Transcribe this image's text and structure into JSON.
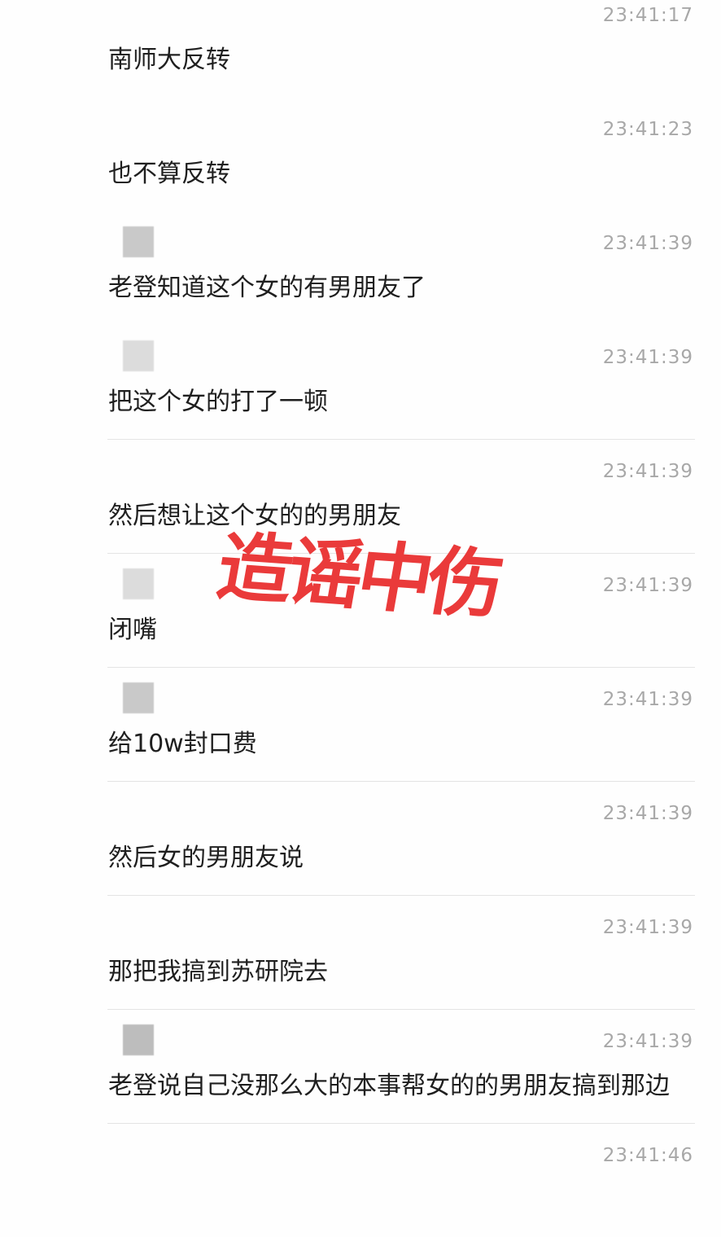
{
  "messages": [
    {
      "text": "南师大反转",
      "time": "23:41:17",
      "avatar": false,
      "divider": false
    },
    {
      "text": "也不算反转",
      "time": "23:41:23",
      "avatar": false,
      "divider": false
    },
    {
      "text": "老登知道这个女的有男朋友了",
      "time": "23:41:39",
      "avatar": true,
      "divider": false
    },
    {
      "text": "把这个女的打了一顿",
      "time": "23:41:39",
      "avatar": true,
      "divider": false
    },
    {
      "text": "然后想让这个女的的男朋友",
      "time": "23:41:39",
      "avatar": false,
      "divider": true
    },
    {
      "text": "闭嘴",
      "time": "23:41:39",
      "avatar": true,
      "divider": true
    },
    {
      "text": "给10w封口费",
      "time": "23:41:39",
      "avatar": true,
      "divider": true
    },
    {
      "text": "然后女的男朋友说",
      "time": "23:41:39",
      "avatar": false,
      "divider": true
    },
    {
      "text": "那把我搞到苏研院去",
      "time": "23:41:39",
      "avatar": false,
      "divider": true
    },
    {
      "text": "老登说自己没那么大的本事帮女的的男朋友搞到那边",
      "time": "23:41:39",
      "avatar": true,
      "divider": true
    },
    {
      "text": "",
      "time": "23:41:46",
      "avatar": false,
      "divider": true
    }
  ],
  "stamp": {
    "text": "造谣中伤",
    "color": "#ea3a3a"
  }
}
